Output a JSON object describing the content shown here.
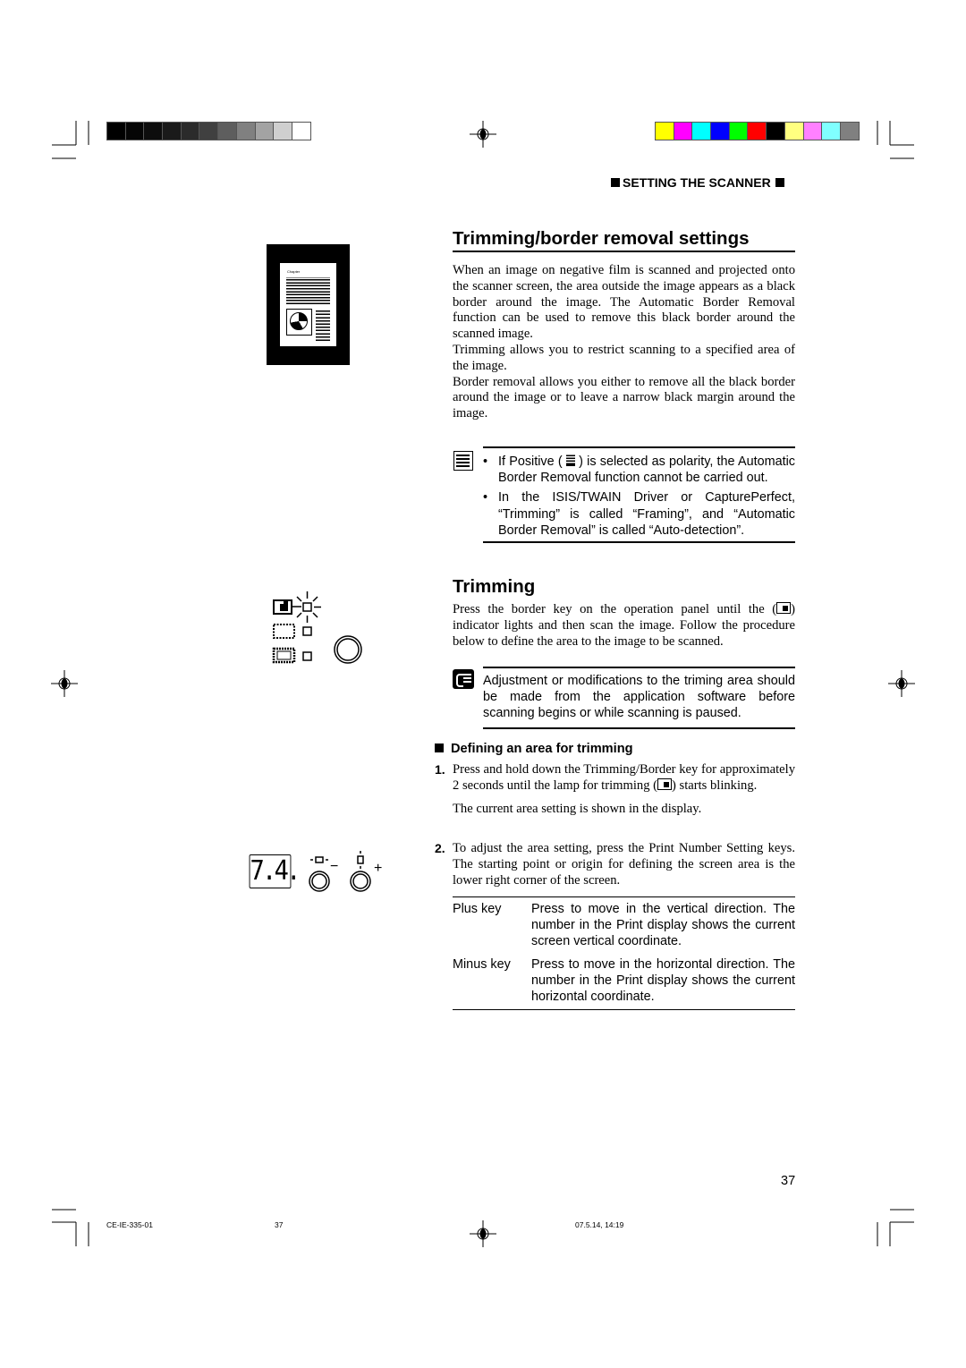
{
  "print_marks": {
    "grayscale_bar": [
      "#000000",
      "#050505",
      "#0d0d0d",
      "#1a1a1a",
      "#2b2b2b",
      "#404040",
      "#5e5e5e",
      "#808080",
      "#a3a3a3",
      "#cfcfcf",
      "#ffffff"
    ],
    "color_bar": [
      "#ffff00",
      "#ff00ff",
      "#00ffff",
      "#0000ff",
      "#00ff00",
      "#ff0000",
      "#000000",
      "#ffff80",
      "#ff80ff",
      "#80ffff",
      "#808080"
    ]
  },
  "header": {
    "section": "SETTING THE SCANNER"
  },
  "main": {
    "title": "Trimming/border removal settings",
    "intro": [
      "When an image on negative film is scanned and projected onto the scanner screen, the area outside the image appears as a black border around the image. The Automatic Border Removal function can be used to remove this black border around the scanned image.",
      "Trimming allows you to restrict scanning to a specified area of the image.",
      "Border removal allows you either to remove all the black border around the image or to leave a narrow black margin around the image."
    ],
    "note1": {
      "icon": "note-icon",
      "bullet1_a": "If Positive (",
      "bullet1_b": ")  is selected as polarity, the Automatic Border Removal function cannot be carried out.",
      "bullet2": "In the ISIS/TWAIN Driver or CapturePerfect, “Trimming” is called “Framing”, and “Automatic Border Removal” is called “Auto-detection”."
    },
    "trimming": {
      "heading": "Trimming",
      "body_a": "Press the border key on the operation panel until the  (",
      "body_b": ") indicator lights and then scan the image. Follow the procedure below to define the area to the image to be scanned.",
      "note": {
        "icon": "caution-icon",
        "text": "Adjustment or modifications to the triming area should be made from the application software before scanning begins or while scanning is paused."
      }
    },
    "defining": {
      "heading": "Defining an area for trimming",
      "step1": {
        "num": "1.",
        "text_a": "Press and hold down  the Trimming/Border key for approximately 2 seconds until the lamp for trimming (",
        "text_b": ") starts blinking.",
        "sub": "The current area setting is shown in the display."
      },
      "step2": {
        "num": "2.",
        "text": "To adjust the area setting, press the Print Number Setting keys. The starting point or origin for defining the screen area is the lower right corner of the screen."
      },
      "keys": [
        {
          "key": "Plus key",
          "desc": "Press to move in the vertical direction. The number in the Print display shows the current screen vertical coordinate."
        },
        {
          "key": "Minus key",
          "desc": "Press to move in the horizontal direction. The number in the Print display shows the current horizontal coordinate."
        }
      ]
    }
  },
  "figures": {
    "document_thumb_label": "Chapter",
    "display_value": "7.4.",
    "minus_label": "−",
    "plus_label": "+"
  },
  "page_number": "37",
  "footer": {
    "code": "CE-IE-335-01",
    "page": "37",
    "timestamp": "07.5.14, 14:19"
  }
}
